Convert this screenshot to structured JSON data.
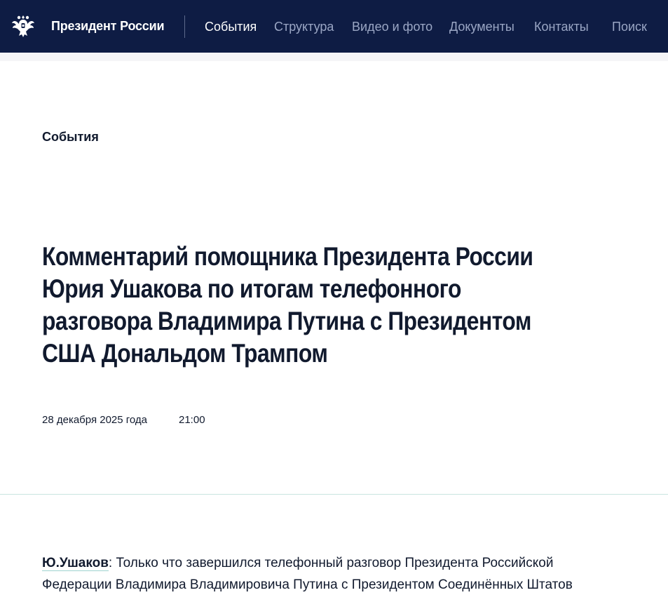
{
  "header": {
    "brand": "Президент России",
    "emblem_icon": "double-headed-eagle-emblem",
    "nav": [
      {
        "label": "События",
        "active": true
      },
      {
        "label": "Структура",
        "active": false
      },
      {
        "label": "Видео и фото",
        "active": false
      },
      {
        "label": "Документы",
        "active": false
      },
      {
        "label": "Контакты",
        "active": false
      },
      {
        "label": "Поиск",
        "active": false
      }
    ]
  },
  "article": {
    "section": "События",
    "title": "Комментарий помощника Президента России Юрия Ушакова по итогам телефонного разговора Владимира Путина с Президентом США Дональдом Трампом",
    "date": "28 декабря 2025 года",
    "time": "21:00",
    "speaker": "Ю.Ушаков",
    "speaker_suffix": ":",
    "body_start": " Только что завершился телефонный разговор Президента Российской Федерации Владимира Владимировича Путина с Президентом Соединённых Штатов"
  },
  "colors": {
    "header_bg": "#0e1c44",
    "nav_inactive": "#9aa6c4",
    "nav_active": "#ffffff",
    "text": "#111a2e",
    "accent_underline": "#9fd3cf"
  }
}
